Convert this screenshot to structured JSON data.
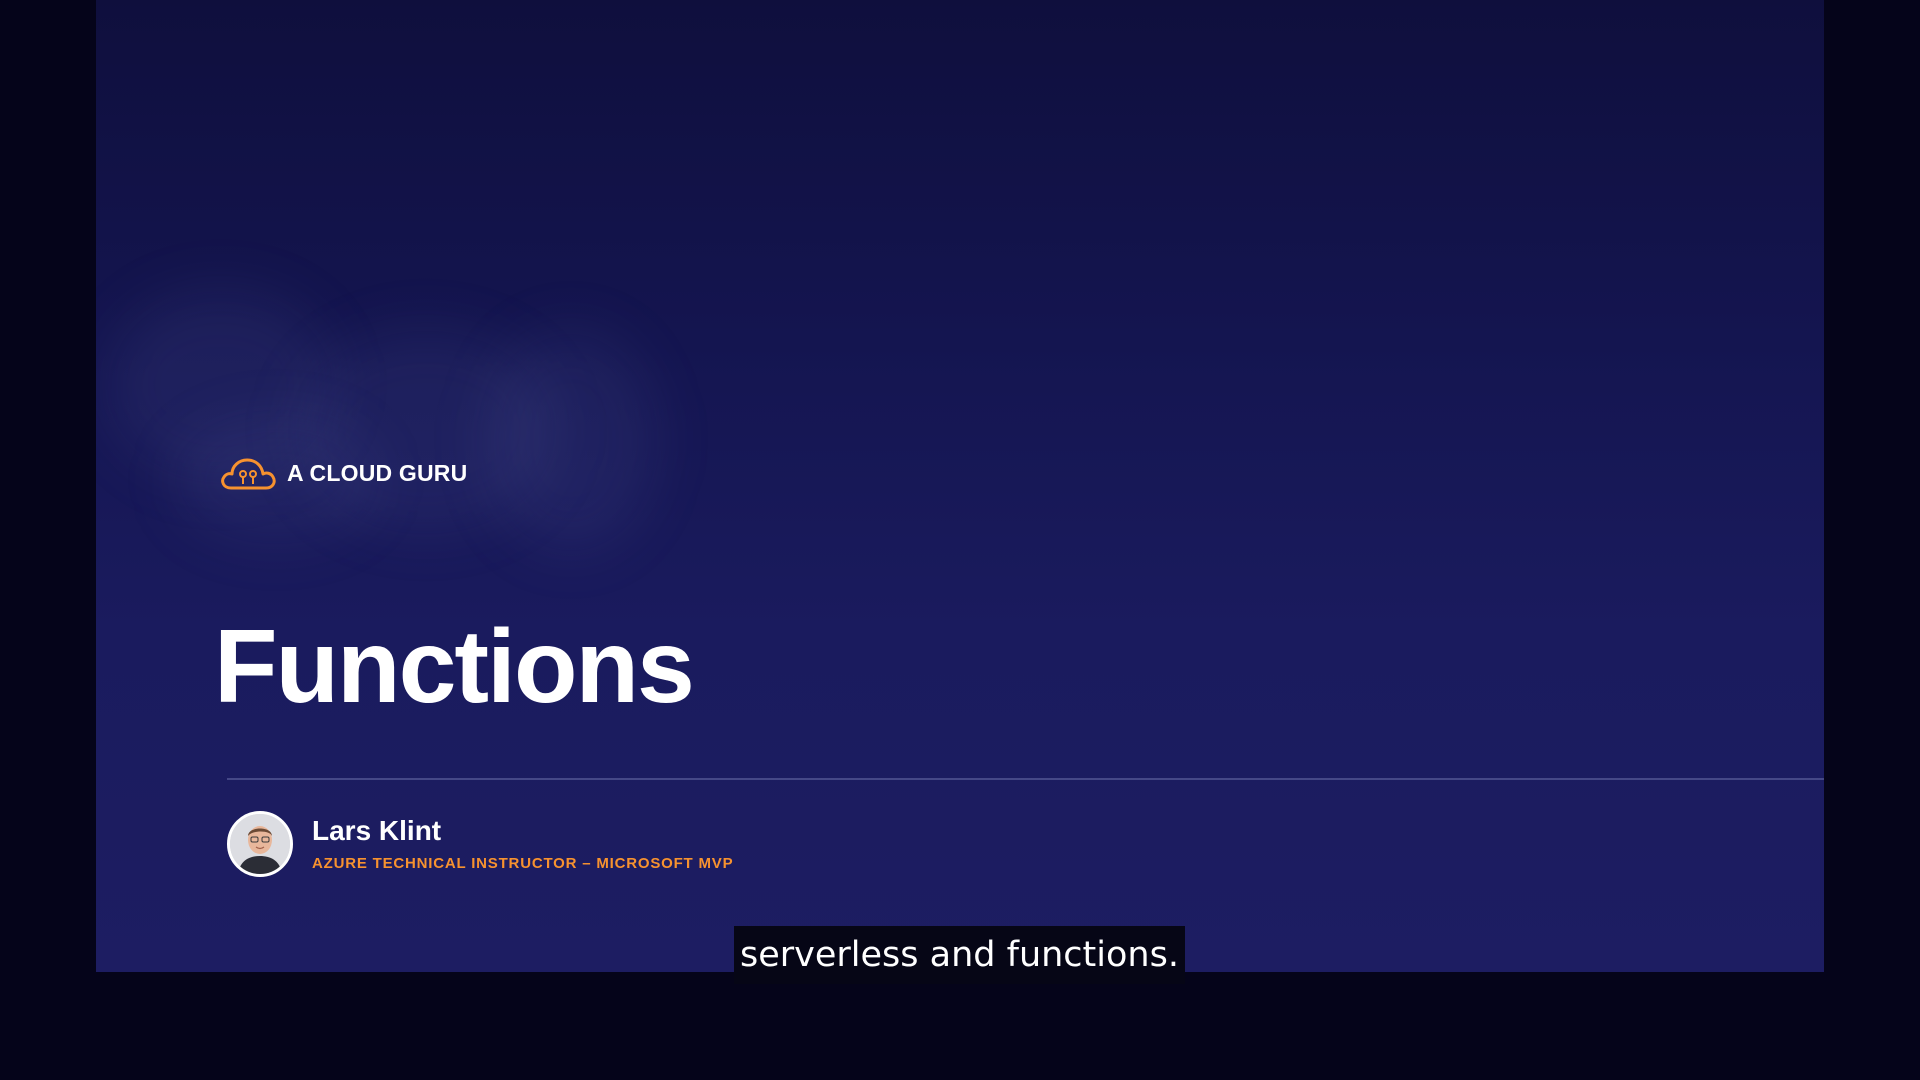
{
  "brand": {
    "name": "A CLOUD GURU",
    "logo_icon": "cloud-logo-icon",
    "accent_color": "#f7922f"
  },
  "slide": {
    "title": "Functions"
  },
  "presenter": {
    "name": "Lars Klint",
    "role": "AZURE TECHNICAL INSTRUCTOR – MICROSOFT MVP"
  },
  "caption": {
    "text": "serverless and functions."
  }
}
